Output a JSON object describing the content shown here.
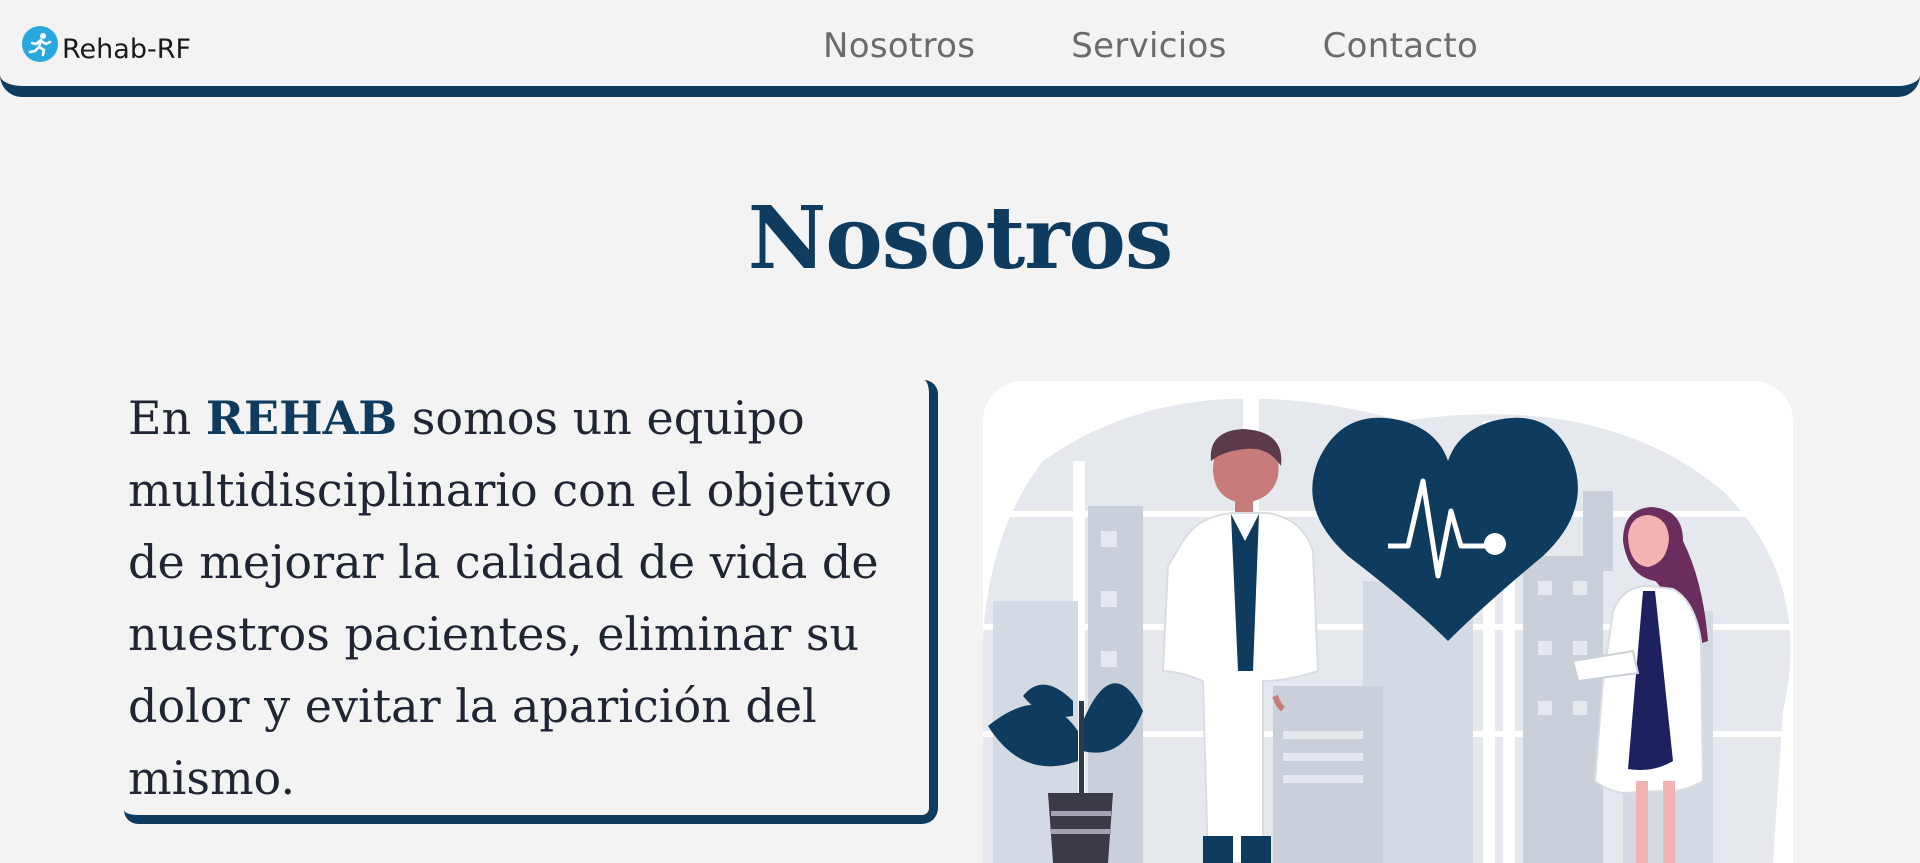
{
  "brand": {
    "name": "Rehab-RF",
    "logo_icon": "runner-icon",
    "logo_color": "#29a8e0"
  },
  "nav": {
    "items": [
      "Nosotros",
      "Servicios",
      "Contacto"
    ]
  },
  "about": {
    "title": "Nosotros",
    "text_before": "En ",
    "highlight": "REHAB",
    "text_after": " somos un equipo multidisciplinario con el objetivo de mejorar la calidad de vida de nuestros pacientes, eliminar su dolor y evitar la aparición del mismo."
  },
  "illustration": {
    "icon": "doctors-heart-illustration"
  },
  "colors": {
    "accent": "#0e3b5e",
    "background": "#f3f3f3",
    "text": "#1f2533"
  }
}
